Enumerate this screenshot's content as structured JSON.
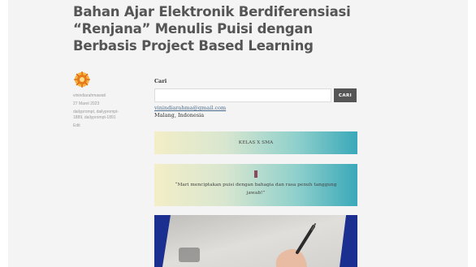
{
  "post": {
    "title_lines": [
      "Bahan Ajar Elektronik Berdiferensiasi",
      "“Renjana” Menulis Puisi dengan",
      "Berbasis Project Based Learning"
    ]
  },
  "meta": {
    "author": "vinindiarahmawati",
    "date": "27 Maret 2023",
    "tags": "dailyprompt, dailyprompt-1889, dailyprompt-1891",
    "edit": "Edit",
    "avatar_icon": "orange-pattern-avatar-icon"
  },
  "search": {
    "label": "Cari",
    "placeholder": "",
    "button": "CARI"
  },
  "contact": {
    "email": "vinindiarahma@gmail.com",
    "city": "Malang, Indonesia"
  },
  "kelas_label": "KELAS X SMA",
  "quote": "“Mari menciptakan puisi dengan bahagia dan rasa penuh tanggung jawab!”",
  "colors": {
    "title": "#555555",
    "gradient_start": "#f3eec7",
    "gradient_end": "#3aa8b9",
    "button_bg": "#555555",
    "frame_blue": "#1a2f8f"
  }
}
